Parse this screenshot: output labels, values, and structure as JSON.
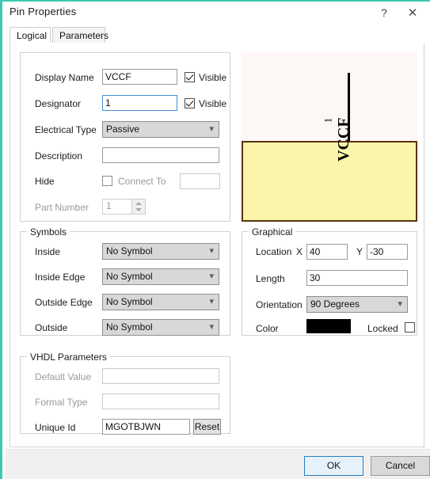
{
  "window": {
    "title": "Pin Properties",
    "help_icon": "?",
    "close_icon": "✕"
  },
  "tabs": [
    {
      "label": "Logical",
      "active": true
    },
    {
      "label": "Parameters",
      "active": false
    }
  ],
  "logical": {
    "display_name": {
      "label": "Display Name",
      "value": "VCCF",
      "visible_label": "Visible",
      "visible_checked": true
    },
    "designator": {
      "label": "Designator",
      "value": "1",
      "visible_label": "Visible",
      "visible_checked": true,
      "focused": true
    },
    "electrical_type": {
      "label": "Electrical Type",
      "value": "Passive",
      "options": [
        "Passive"
      ]
    },
    "description": {
      "label": "Description",
      "value": ""
    },
    "hide": {
      "label": "Hide",
      "checked": false,
      "connect_to_label": "Connect To",
      "connect_to_value": ""
    },
    "part_number": {
      "label": "Part Number",
      "value": "1",
      "disabled": true
    }
  },
  "symbols": {
    "legend": "Symbols",
    "rows": [
      {
        "label": "Inside",
        "value": "No Symbol"
      },
      {
        "label": "Inside Edge",
        "value": "No Symbol"
      },
      {
        "label": "Outside Edge",
        "value": "No Symbol"
      },
      {
        "label": "Outside",
        "value": "No Symbol"
      }
    ]
  },
  "graphical": {
    "legend": "Graphical",
    "location_label": "Location",
    "x_label": "X",
    "x_value": "40",
    "y_label": "Y",
    "y_value": "-30",
    "length_label": "Length",
    "length_value": "30",
    "orientation_label": "Orientation",
    "orientation_value": "90 Degrees",
    "color_label": "Color",
    "color_value": "#000000",
    "locked_label": "Locked",
    "locked_checked": false
  },
  "vhdl": {
    "legend": "VHDL Parameters",
    "default_value_label": "Default Value",
    "default_value": "",
    "formal_type_label": "Formal Type",
    "formal_type": "",
    "unique_id_label": "Unique Id",
    "unique_id": "MGOTBJWN",
    "reset_label": "Reset"
  },
  "preview": {
    "pin_number": "1",
    "pin_name": "VCCF",
    "body_color": "#faf5a8",
    "body_border_color": "#5a3410",
    "background_color": "#fdf8f6",
    "pin_color": "#000000"
  },
  "footer": {
    "ok_label": "OK",
    "cancel_label": "Cancel"
  }
}
